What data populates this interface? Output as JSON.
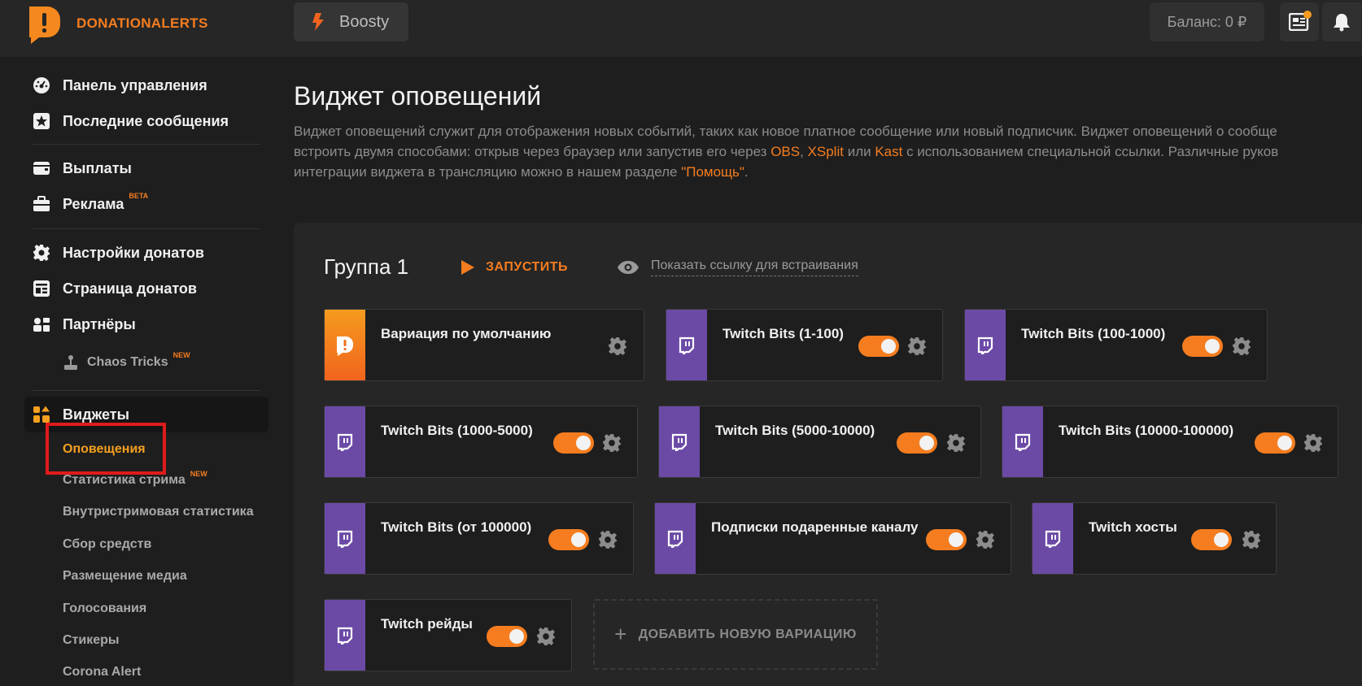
{
  "header": {
    "brand": "DONATIONALERTS",
    "boosty_label": "Boosty",
    "balance": "Баланс: 0 ₽",
    "brand_color": "#f57d1f"
  },
  "sidebar": {
    "items": [
      {
        "label": "Панель управления",
        "icon": "dashboard-icon"
      },
      {
        "label": "Последние сообщения",
        "icon": "star-icon"
      },
      {
        "label": "Выплаты",
        "icon": "wallet-icon"
      },
      {
        "label": "Реклама",
        "icon": "briefcase-icon",
        "badge": "BETA"
      },
      {
        "label": "Настройки донатов",
        "icon": "gear-icon"
      },
      {
        "label": "Страница донатов",
        "icon": "page-icon"
      },
      {
        "label": "Партнёры",
        "icon": "partners-icon"
      },
      {
        "label": "Виджеты",
        "icon": "widgets-icon"
      }
    ],
    "partner_sub": {
      "label": "Chaos Tricks",
      "badge": "NEW"
    },
    "widget_subs": [
      {
        "label": "Оповещения",
        "active": true
      },
      {
        "label": "Статистика стрима",
        "badge": "NEW"
      },
      {
        "label": "Внутристримовая статистика"
      },
      {
        "label": "Сбор средств"
      },
      {
        "label": "Размещение медиа"
      },
      {
        "label": "Голосования"
      },
      {
        "label": "Стикеры"
      },
      {
        "label": "Corona Alert"
      }
    ]
  },
  "main": {
    "title": "Виджет оповещений",
    "desc_line1": "Виджет оповещений служит для отображения новых событий, таких как новое платное сообщение или новый подписчик. Виджет оповещений о сообще",
    "desc_line2_a": "встроить двумя способами: открыв через браузер или запустив его через ",
    "desc_link_obs": "OBS",
    "desc_comma": ", ",
    "desc_link_xsplit": "XSplit",
    "desc_or": " или ",
    "desc_link_kast": "Kast",
    "desc_line2_b": " с использованием специальной ссылки. Различные руков",
    "desc_line3_a": "интеграции виджета в трансляцию можно в нашем разделе ",
    "desc_link_help": "\"Помощь\"",
    "desc_dot": ".",
    "group": {
      "title": "Группа 1",
      "run_label": "ЗАПУСТИТЬ",
      "embed_label": "Показать ссылку для встраивания",
      "variations": [
        {
          "title": "Вариация по умолчанию",
          "type": "default",
          "enabled": null
        },
        {
          "title": "Twitch Bits (1-100)",
          "type": "twitch",
          "enabled": true
        },
        {
          "title": "Twitch Bits (100-1000)",
          "type": "twitch",
          "enabled": true
        },
        {
          "title": "Twitch Bits (1000-5000)",
          "type": "twitch",
          "enabled": true
        },
        {
          "title": "Twitch Bits (5000-10000)",
          "type": "twitch",
          "enabled": true
        },
        {
          "title": "Twitch Bits (10000-100000)",
          "type": "twitch",
          "enabled": true
        },
        {
          "title": "Twitch Bits (от 100000)",
          "type": "twitch",
          "enabled": true
        },
        {
          "title": "Подписки подаренные каналу",
          "type": "twitch",
          "enabled": true
        },
        {
          "title": "Twitch хосты",
          "type": "twitch",
          "enabled": true
        },
        {
          "title": "Twitch рейды",
          "type": "twitch",
          "enabled": true
        }
      ],
      "add_label": "ДОБАВИТЬ НОВУЮ ВАРИАЦИЮ"
    }
  }
}
